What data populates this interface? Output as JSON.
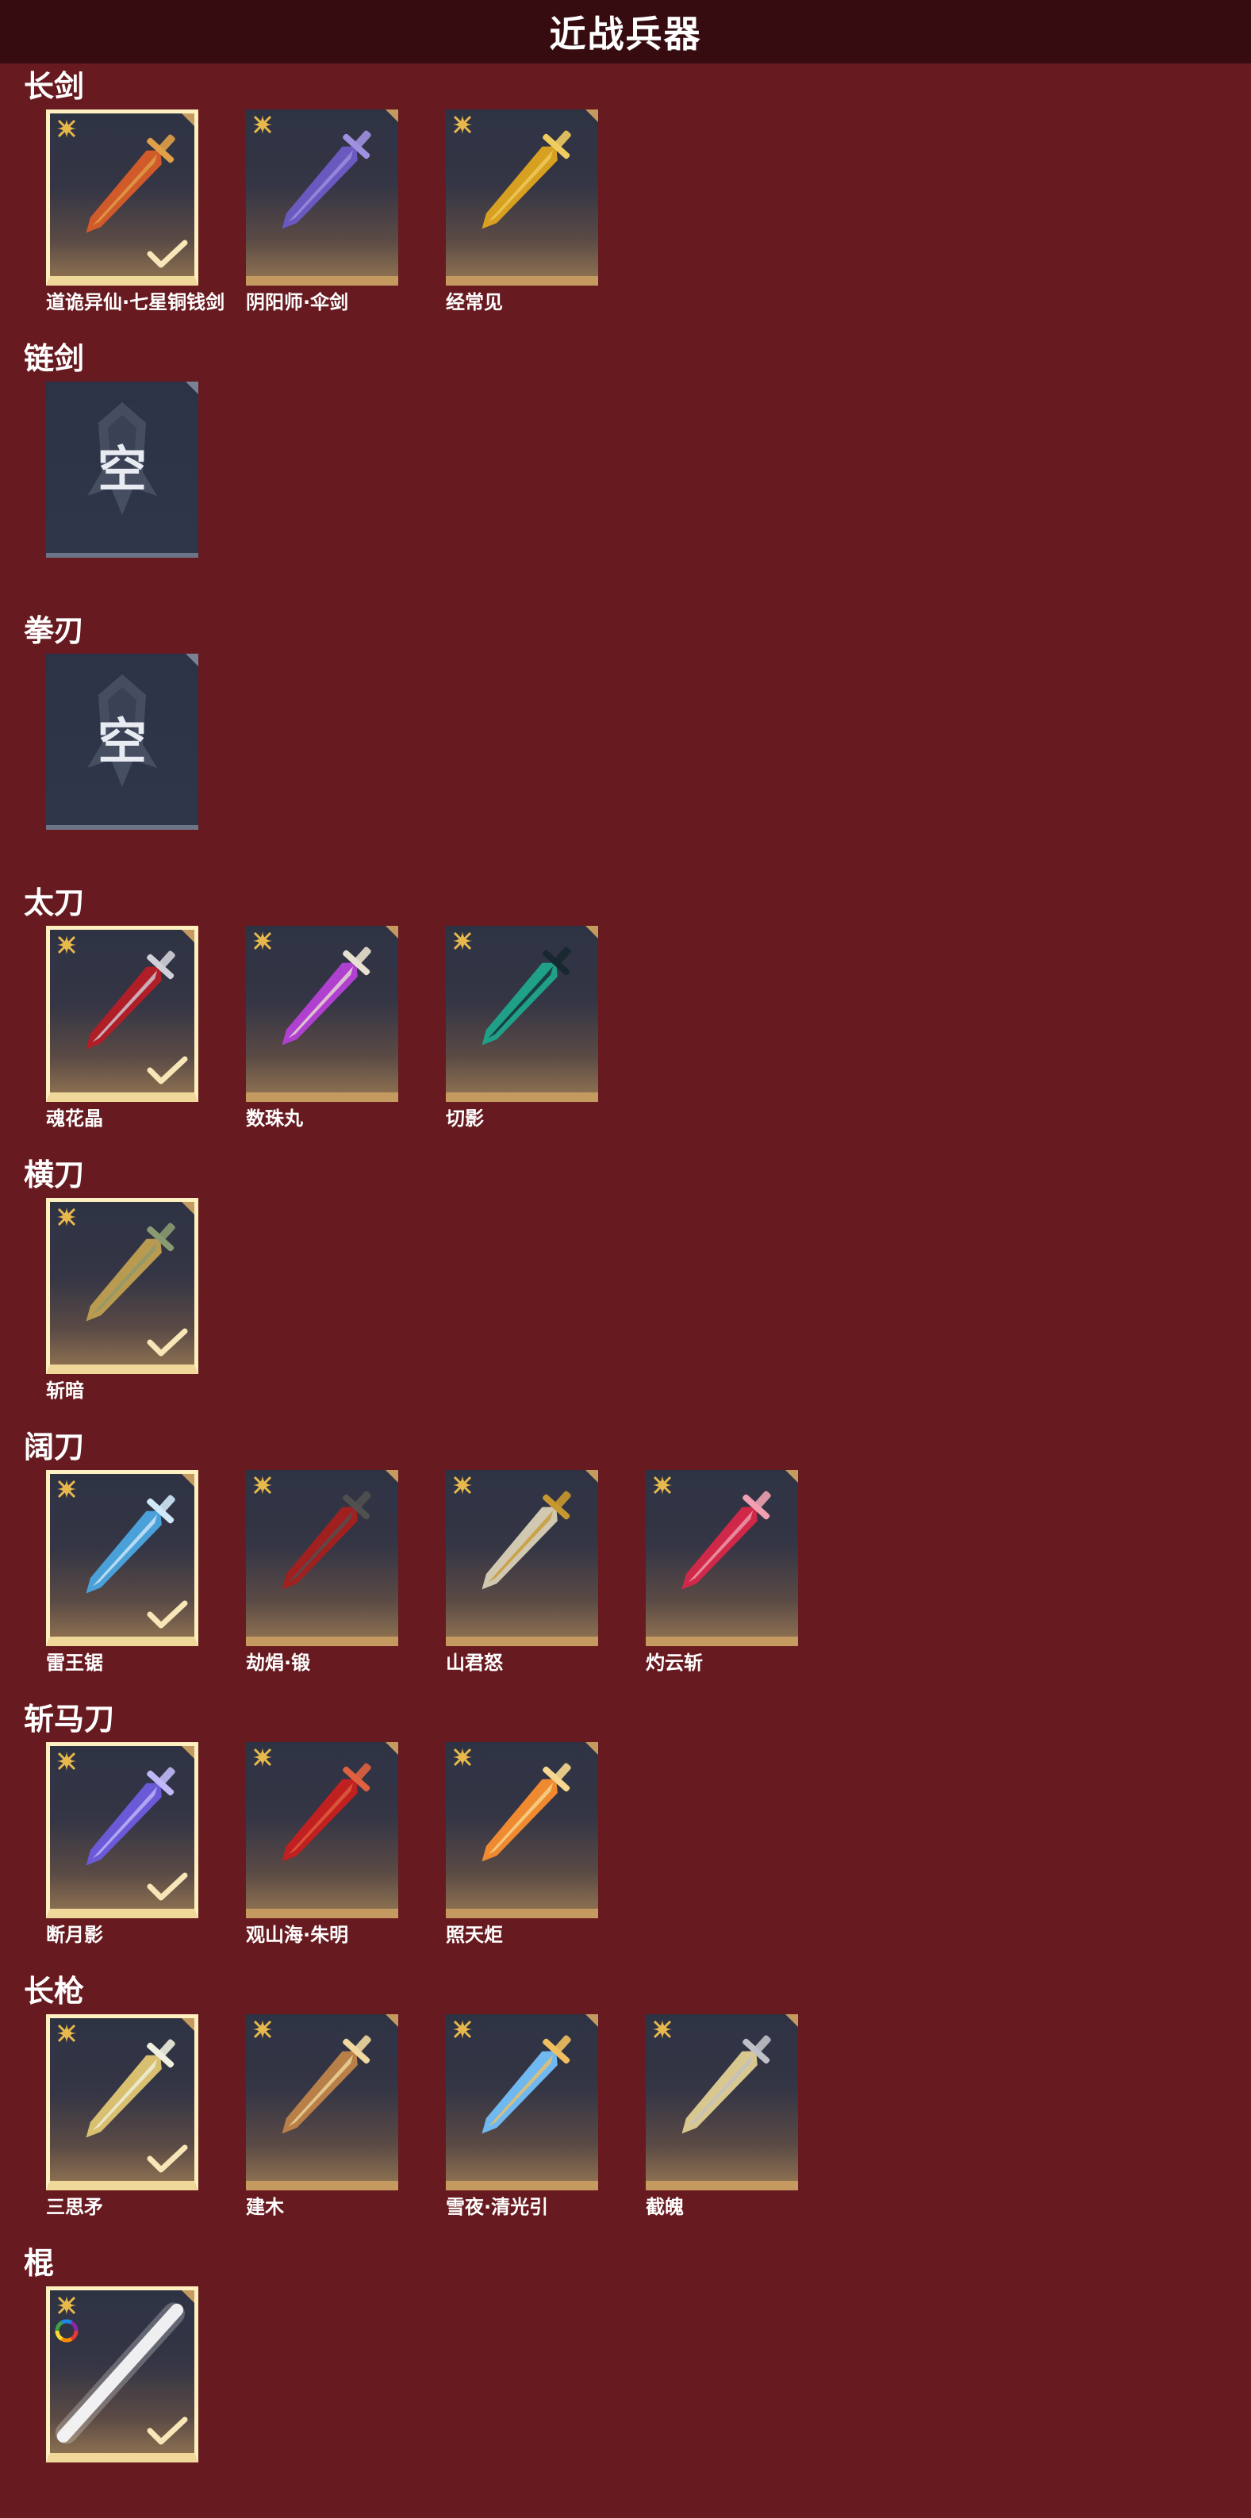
{
  "title": "近战兵器",
  "empty_label": "空",
  "sections": [
    {
      "title": "长剑",
      "items": [
        {
          "label": "道诡异仙·七星铜钱剑",
          "equipped": true,
          "color": "#d05a2a",
          "accent": "#e0a048"
        },
        {
          "label": "阴阳师·伞剑",
          "equipped": false,
          "color": "#6a5ac0",
          "accent": "#a090e0"
        },
        {
          "label": "经常见",
          "equipped": false,
          "color": "#d8a020",
          "accent": "#f0cc60"
        }
      ]
    },
    {
      "title": "链剑",
      "items": []
    },
    {
      "title": "拳刃",
      "items": []
    },
    {
      "title": "太刀",
      "items": [
        {
          "label": "魂花晶",
          "equipped": true,
          "color": "#b01e28",
          "accent": "#d0d0d8"
        },
        {
          "label": "数珠丸",
          "equipped": false,
          "color": "#b040d0",
          "accent": "#e8e0d0"
        },
        {
          "label": "切影",
          "equipped": false,
          "color": "#20a088",
          "accent": "#182830"
        }
      ]
    },
    {
      "title": "横刀",
      "items": [
        {
          "label": "斩暗",
          "equipped": true,
          "color": "#b89a50",
          "accent": "#8a9a70"
        }
      ]
    },
    {
      "title": "阔刀",
      "items": [
        {
          "label": "雷王锯",
          "equipped": true,
          "color": "#4aa0d8",
          "accent": "#d0e8f8"
        },
        {
          "label": "劫焆·锻",
          "equipped": false,
          "color": "#a02020",
          "accent": "#505050"
        },
        {
          "label": "山君怒",
          "equipped": false,
          "color": "#d0c8b0",
          "accent": "#c89830"
        },
        {
          "label": "灼云斩",
          "equipped": false,
          "color": "#d02848",
          "accent": "#f0a0b0"
        }
      ]
    },
    {
      "title": "斩马刀",
      "items": [
        {
          "label": "断月影",
          "equipped": true,
          "color": "#6a5ad8",
          "accent": "#c0b8f8"
        },
        {
          "label": "观山海·朱明",
          "equipped": false,
          "color": "#c02020",
          "accent": "#e06040"
        },
        {
          "label": "照天炬",
          "equipped": false,
          "color": "#f08a30",
          "accent": "#f8d890"
        }
      ]
    },
    {
      "title": "长枪",
      "items": [
        {
          "label": "三思矛",
          "equipped": true,
          "color": "#d8c070",
          "accent": "#f0f0e0"
        },
        {
          "label": "建木",
          "equipped": false,
          "color": "#b88048",
          "accent": "#f0d8a0"
        },
        {
          "label": "雪夜·清光引",
          "equipped": false,
          "color": "#70b8f0",
          "accent": "#f0c060"
        },
        {
          "label": "截魄",
          "equipped": false,
          "color": "#d8c890",
          "accent": "#c0c0c8"
        }
      ]
    },
    {
      "title": "棍",
      "items": [
        {
          "label": "",
          "equipped": true,
          "rainbow": true,
          "color": "#f4f4f8",
          "accent": "#ffffff"
        }
      ]
    }
  ]
}
